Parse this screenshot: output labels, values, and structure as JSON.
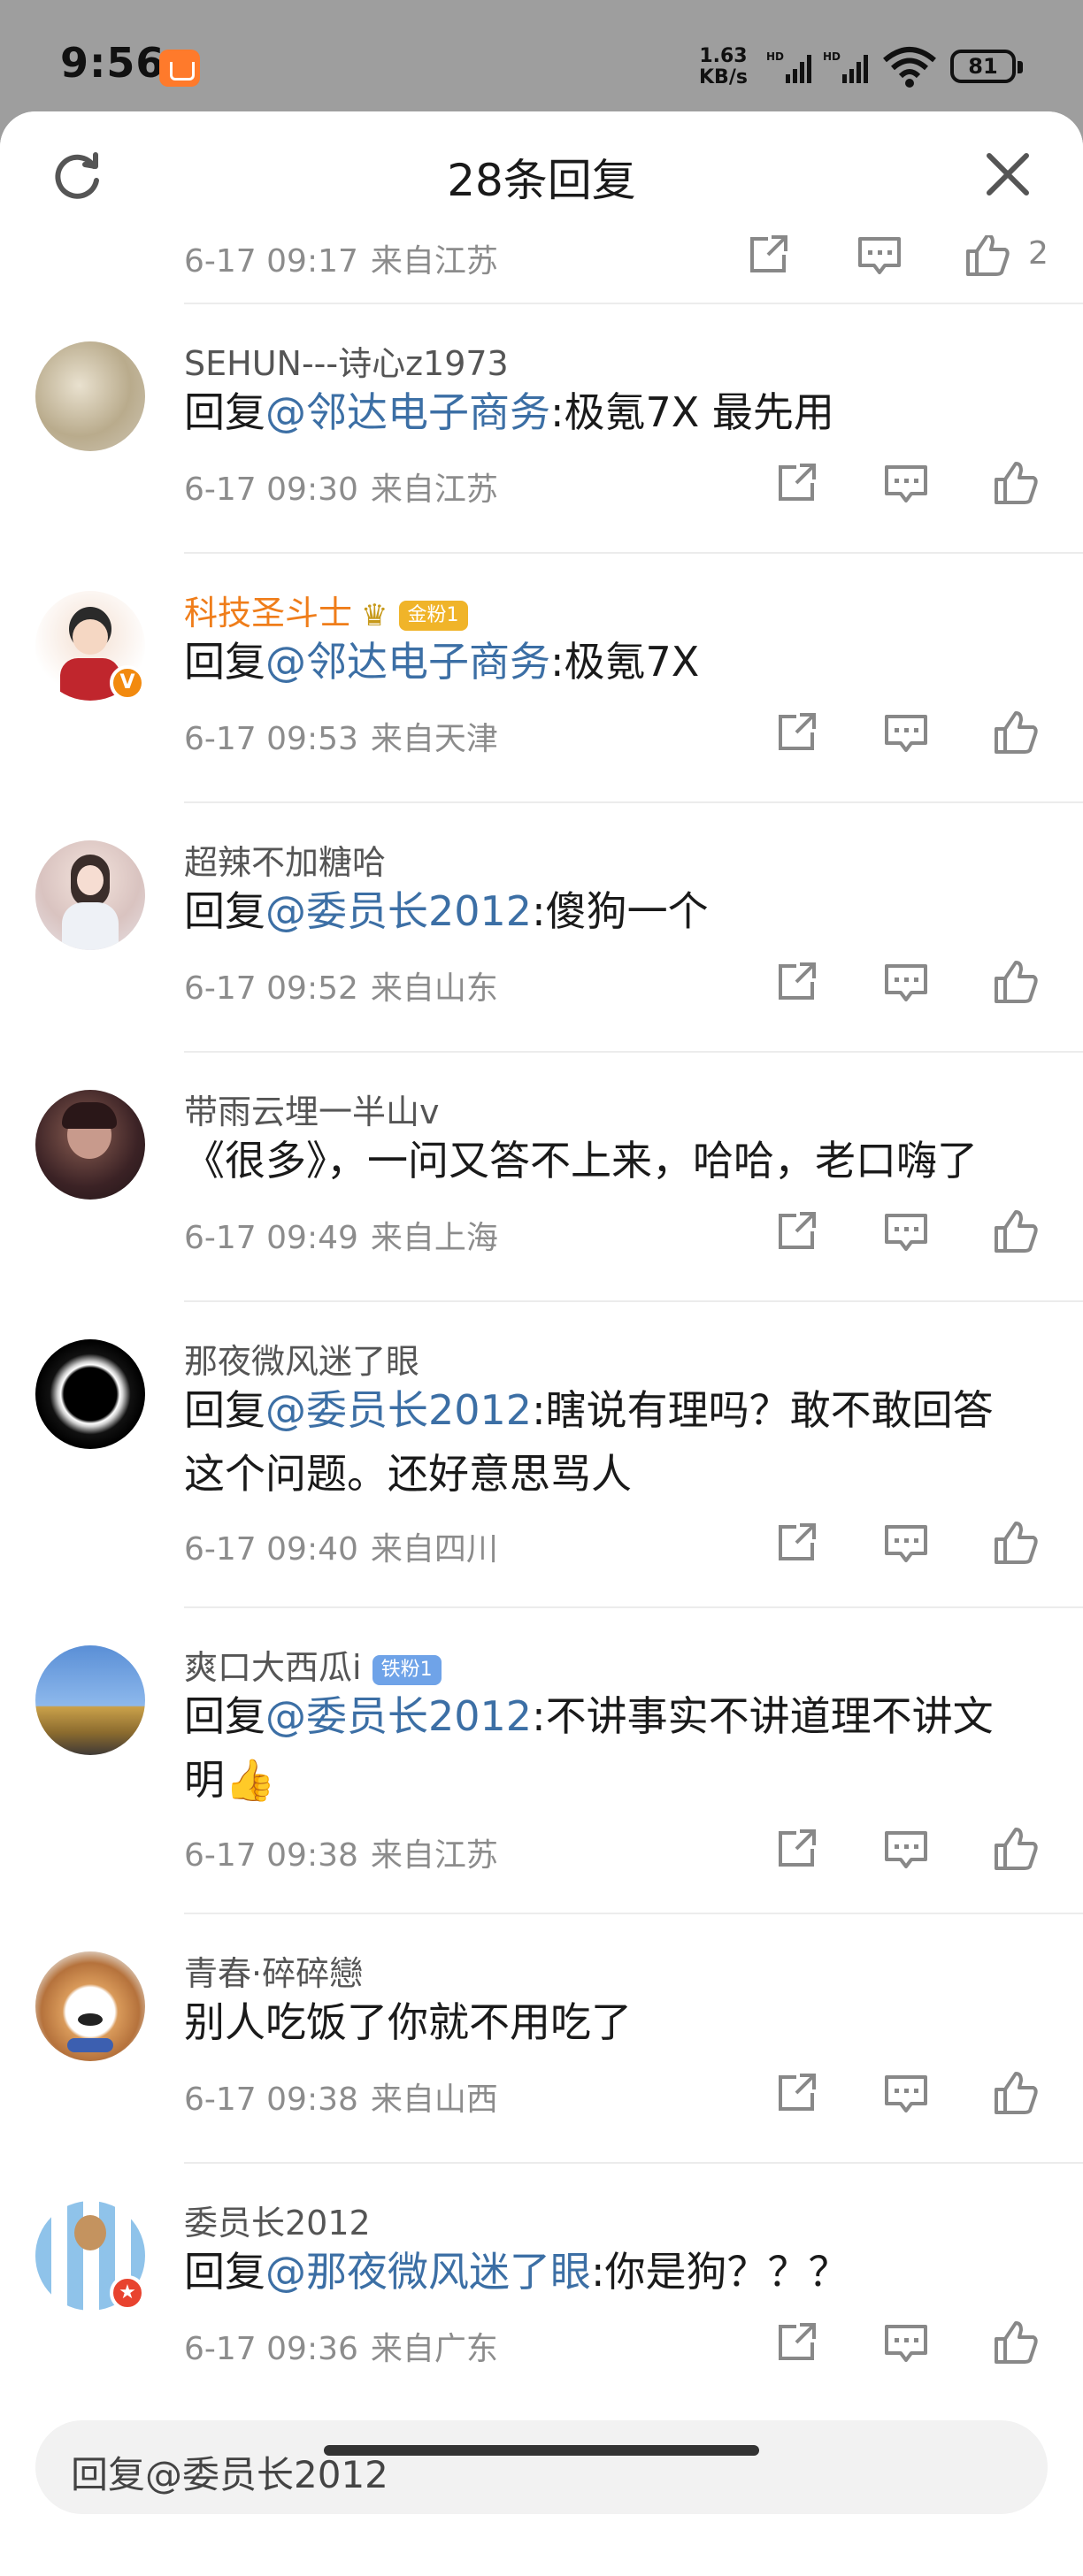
{
  "status_bar": {
    "time": "9:56",
    "speed_value": "1.63",
    "speed_unit": "KB/s",
    "signal_1": "HD",
    "signal_2": "HD",
    "battery": "81"
  },
  "header": {
    "title": "28条回复",
    "refresh_icon": "refresh-icon",
    "close_icon": "close-icon"
  },
  "partial_comment": {
    "time": "6-17 09:17",
    "location": "来自江苏",
    "like_count": "2"
  },
  "comments": [
    {
      "user": "SEHUN---诗心z1973",
      "prefix": "回复",
      "mention": "@邻达电子商务",
      "text": ":极氪7X 最先用",
      "time": "6-17 09:30",
      "location": "来自江苏"
    },
    {
      "user": "科技圣斗士",
      "badge": "金粉1",
      "prefix": "回复",
      "mention": "@邻达电子商务",
      "text": ":极氪7X",
      "time": "6-17 09:53",
      "location": "来自天津"
    },
    {
      "user": "超辣不加糖哈",
      "prefix": "回复",
      "mention": "@委员长2012",
      "text": ":傻狗一个",
      "time": "6-17 09:52",
      "location": "来自山东"
    },
    {
      "user": "带雨云埋一半山v",
      "text": "《很多》，一问又答不上来，哈哈，老口嗨了",
      "time": "6-17 09:49",
      "location": "来自上海"
    },
    {
      "user": "那夜微风迷了眼",
      "prefix": "回复",
      "mention": "@委员长2012",
      "text": ":瞎说有理吗？敢不敢回答这个问题。还好意思骂人",
      "time": "6-17 09:40",
      "location": "来自四川"
    },
    {
      "user": "爽口大西瓜i",
      "badge": "铁粉1",
      "prefix": "回复",
      "mention": "@委员长2012",
      "text": ":不讲事实不讲道理不讲文明👍",
      "time": "6-17 09:38",
      "location": "来自江苏"
    },
    {
      "user": "青春·碎碎戀",
      "text": "别人吃饭了你就不用吃了",
      "time": "6-17 09:38",
      "location": "来自山西"
    },
    {
      "user": "委员长2012",
      "prefix": "回复",
      "mention": "@那夜微风迷了眼",
      "text": ":你是狗？？？",
      "time": "6-17 09:36",
      "location": "来自广东"
    }
  ],
  "reply_box": {
    "placeholder": "回复@委员长2012"
  },
  "colors": {
    "mention": "#3c6fa5",
    "orange_name": "#ef7d1a",
    "gold_badge": "#f0b429",
    "iron_badge": "#6fa3e8",
    "meta": "#8c8c8c"
  },
  "icons": [
    "share-icon",
    "comment-icon",
    "like-icon"
  ]
}
